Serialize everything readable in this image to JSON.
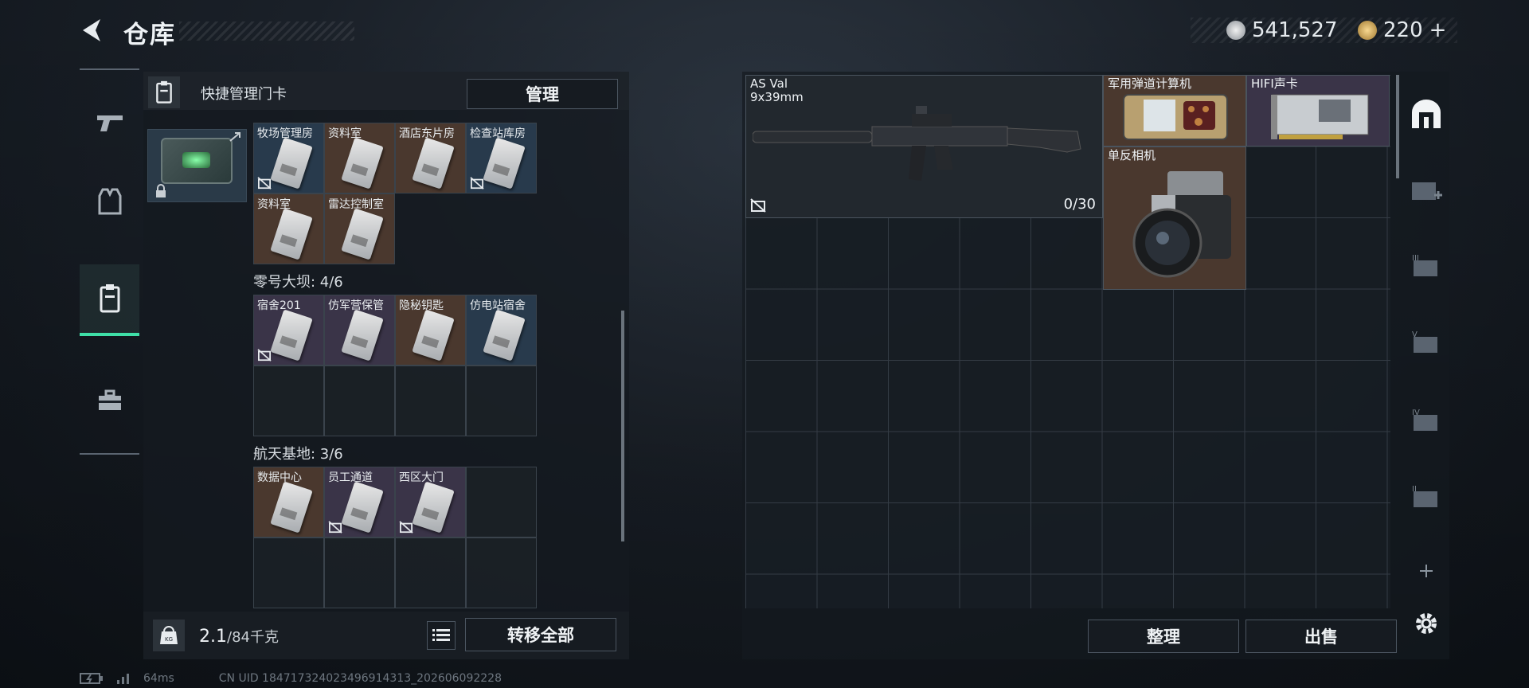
{
  "header": {
    "title": "仓库",
    "currency_silver": "541,527",
    "currency_gold": "220",
    "currency_gold_plus": "+"
  },
  "quick_manage": {
    "label": "快捷管理门卡",
    "manage_button": "管理"
  },
  "keycard_sections": [
    {
      "title": "",
      "cards": [
        {
          "name": "牧场管理房",
          "color": "blue",
          "locked": true
        },
        {
          "name": "资料室",
          "color": "brown",
          "locked": false
        },
        {
          "name": "酒店东片房",
          "color": "brown",
          "locked": false
        },
        {
          "name": "检查站库房",
          "color": "blue",
          "locked": true
        },
        {
          "name": "资料室",
          "color": "brown",
          "locked": false
        },
        {
          "name": "雷达控制室",
          "color": "brown",
          "locked": false
        }
      ]
    },
    {
      "title": "零号大坝: 4/6",
      "cards": [
        {
          "name": "宿舍201",
          "color": "purple",
          "locked": true
        },
        {
          "name": "仿军营保管",
          "color": "purple",
          "locked": false
        },
        {
          "name": "隐秘钥匙",
          "color": "brown",
          "locked": false
        },
        {
          "name": "仿电站宿舍",
          "color": "blue",
          "locked": false
        }
      ]
    },
    {
      "title": "航天基地: 3/6",
      "cards": [
        {
          "name": "数据中心",
          "color": "brown",
          "locked": false
        },
        {
          "name": "员工通道",
          "color": "purple",
          "locked": true
        },
        {
          "name": "西区大门",
          "color": "purple",
          "locked": true
        }
      ]
    }
  ],
  "footer_left": {
    "weight_current": "2.1",
    "weight_max": "/84千克",
    "transfer_all_button": "转移全部"
  },
  "storage_items": [
    {
      "name": "AS Val",
      "sub": "9x39mm",
      "ammo": "0/30",
      "color": "#22282e"
    },
    {
      "name": "军用弹道计算机",
      "color": "#4a382e"
    },
    {
      "name": "HIFI声卡",
      "color": "#3a3448"
    },
    {
      "name": "单反相机",
      "color": "#4a382e"
    }
  ],
  "footer_right": {
    "sort_button": "整理",
    "sell_button": "出售"
  },
  "status": {
    "ping": "64ms",
    "uid": "CN UID 184717324023496914313_202606092228"
  },
  "colors": {
    "accent_green": "#3fe0a8",
    "brown_slot": "#4a382e",
    "blue_slot": "#283a4c",
    "purple_slot": "#3a3448"
  }
}
